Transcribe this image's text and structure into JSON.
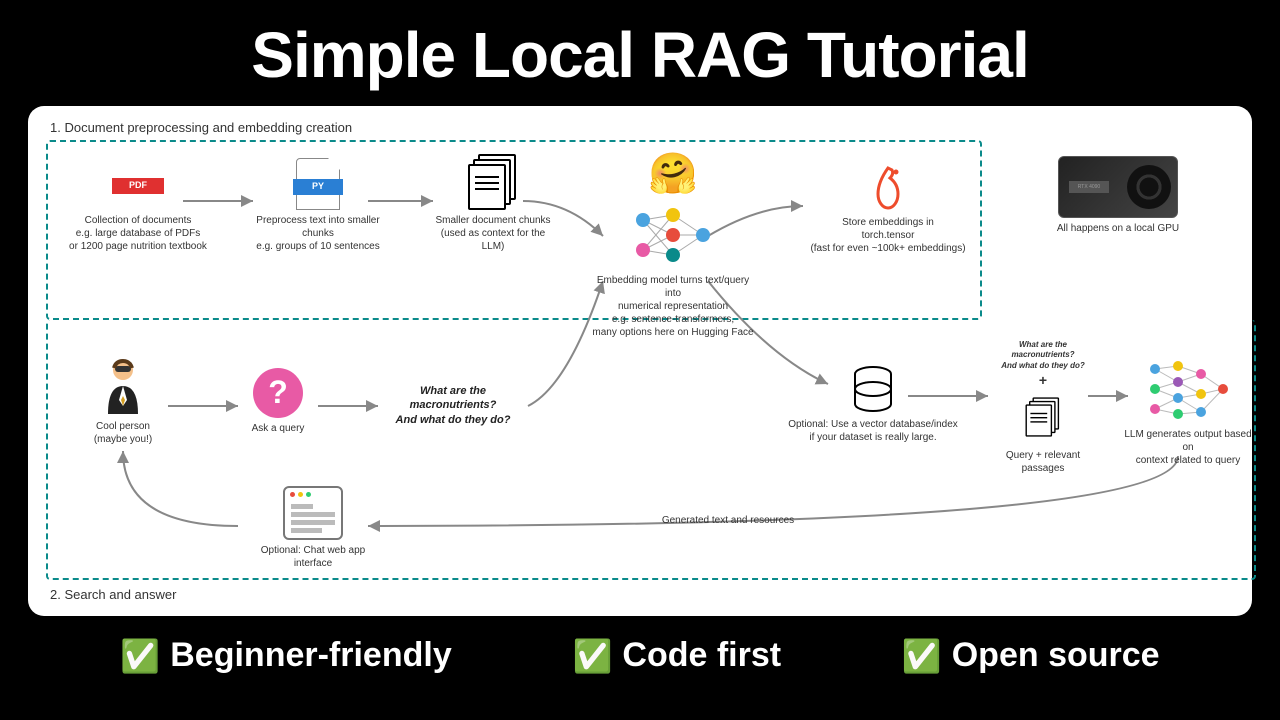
{
  "title": "Simple Local RAG Tutorial",
  "sections": {
    "s1": "1. Document preprocessing and embedding creation",
    "s2": "2. Search and answer"
  },
  "nodes": {
    "pdf": {
      "badge": "PDF",
      "label": "Collection of documents\ne.g. large database of PDFs\nor 1200 page nutrition textbook"
    },
    "py": {
      "badge": "PY",
      "label": "Preprocess text into smaller chunks\ne.g. groups of 10 sentences"
    },
    "chunks": {
      "label": "Smaller document chunks\n(used as context for the LLM)"
    },
    "embed": {
      "label": "Embedding model turns text/query into\nnumerical representation\ne.g. sentence-transformers,\nmany options here on Hugging Face"
    },
    "tensor": {
      "label": "Store embeddings in\ntorch.tensor\n(fast for even ~100k+ embeddings)"
    },
    "gpu": {
      "badge": "RTX 4090",
      "label": "All happens on a local GPU"
    },
    "person": {
      "label": "Cool person\n(maybe you!)"
    },
    "ask": {
      "label": "Ask a query"
    },
    "query": {
      "text": "What are the\nmacronutrients?\nAnd what do they do?"
    },
    "vectordb": {
      "label": "Optional: Use a vector database/index\nif your dataset is really large."
    },
    "retrieved": {
      "label": "Query + relevant passages"
    },
    "llm": {
      "label": "LLM generates output based on\ncontext related to query"
    },
    "webapp": {
      "label": "Optional: Chat web app interface"
    },
    "generated": {
      "label": "Generated text and resources"
    }
  },
  "footer": {
    "f1": "Beginner-friendly",
    "f2": "Code first",
    "f3": "Open source"
  }
}
